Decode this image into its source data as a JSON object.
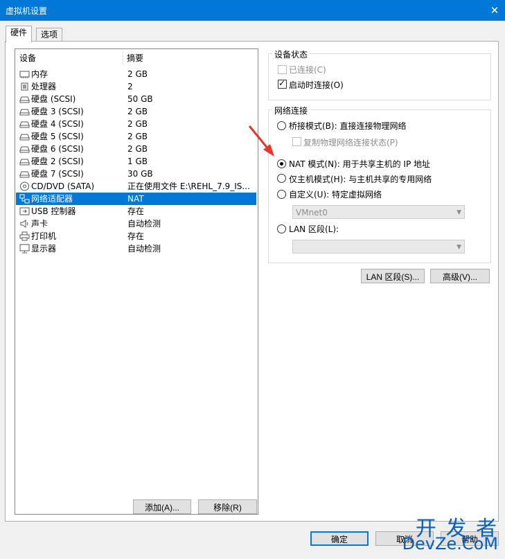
{
  "window": {
    "title": "虚拟机设置",
    "close": "✕"
  },
  "tabs": [
    "硬件",
    "选项"
  ],
  "device_list": {
    "col_device": "设备",
    "col_summary": "摘要",
    "rows": [
      {
        "name": "内存",
        "summary": "2 GB",
        "icon": "memory-icon"
      },
      {
        "name": "处理器",
        "summary": "2",
        "icon": "processor-icon"
      },
      {
        "name": "硬盘 (SCSI)",
        "summary": "50 GB",
        "icon": "hard-disk-icon"
      },
      {
        "name": "硬盘 3 (SCSI)",
        "summary": "2 GB",
        "icon": "hard-disk-icon"
      },
      {
        "name": "硬盘 4 (SCSI)",
        "summary": "2 GB",
        "icon": "hard-disk-icon"
      },
      {
        "name": "硬盘 5 (SCSI)",
        "summary": "2 GB",
        "icon": "hard-disk-icon"
      },
      {
        "name": "硬盘 6 (SCSI)",
        "summary": "2 GB",
        "icon": "hard-disk-icon"
      },
      {
        "name": "硬盘 2 (SCSI)",
        "summary": "1 GB",
        "icon": "hard-disk-icon"
      },
      {
        "name": "硬盘 7 (SCSI)",
        "summary": "30 GB",
        "icon": "hard-disk-icon"
      },
      {
        "name": "CD/DVD (SATA)",
        "summary": "正在使用文件 E:\\REHL_7.9_IS...",
        "icon": "cd-dvd-icon"
      },
      {
        "name": "网络适配器",
        "summary": "NAT",
        "icon": "network-adapter-icon",
        "selected": true
      },
      {
        "name": "USB 控制器",
        "summary": "存在",
        "icon": "usb-icon"
      },
      {
        "name": "声卡",
        "summary": "自动检测",
        "icon": "sound-card-icon"
      },
      {
        "name": "打印机",
        "summary": "存在",
        "icon": "printer-icon"
      },
      {
        "name": "显示器",
        "summary": "自动检测",
        "icon": "display-icon"
      }
    ]
  },
  "buttons": {
    "add": "添加(A)...",
    "remove": "移除(R)",
    "lan_segments": "LAN 区段(S)...",
    "advanced": "高级(V)...",
    "ok": "确定",
    "cancel": "取消",
    "help": "帮助"
  },
  "device_status": {
    "title": "设备状态",
    "connected": {
      "label": "已连接(C)",
      "checked": false,
      "disabled": true
    },
    "connect_on_power_on": {
      "label": "启动时连接(O)",
      "checked": true
    }
  },
  "network": {
    "title": "网络连接",
    "bridged": "桥接模式(B): 直接连接物理网络",
    "replicate": "复制物理网络连接状态(P)",
    "nat": "NAT 模式(N): 用于共享主机的 IP 地址",
    "host_only": "仅主机模式(H): 与主机共享的专用网络",
    "custom": "自定义(U): 特定虚拟网络",
    "custom_value": "VMnet0",
    "lan_segment": "LAN 区段(L):",
    "lan_value": "",
    "selected": "nat"
  },
  "watermark": {
    "line1": "开 发 者",
    "line2": "DevZe.CoM"
  },
  "colors": {
    "accent": "#0078d7",
    "annotation_arrow": "#e8342a"
  }
}
